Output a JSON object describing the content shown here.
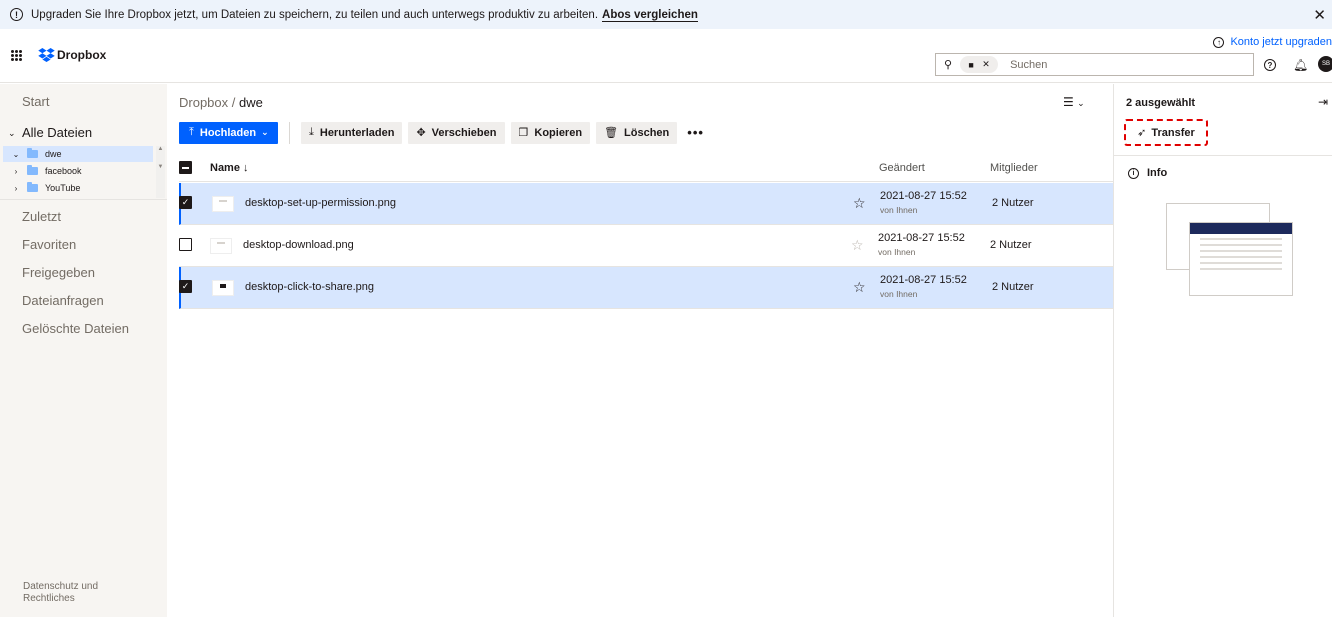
{
  "banner": {
    "text": "Upgraden Sie Ihre Dropbox jetzt, um Dateien zu speichern, zu teilen und auch unterwegs produktiv zu arbeiten.",
    "link": "Abos vergleichen"
  },
  "header": {
    "logo_text": "Dropbox",
    "upgrade_link": "Konto jetzt upgraden",
    "search_placeholder": "Suchen",
    "avatar_initials": "SB"
  },
  "sidebar": {
    "nav": [
      "Start",
      "Alle Dateien",
      "Zuletzt",
      "Favoriten",
      "Freigegeben",
      "Dateianfragen",
      "Gelöschte Dateien"
    ],
    "tree": [
      "dwe",
      "facebook",
      "YouTube"
    ],
    "footer": "Datenschutz und Rechtliches"
  },
  "breadcrumb": {
    "root": "Dropbox",
    "separator": "/",
    "current": "dwe"
  },
  "toolbar": {
    "upload": "Hochladen",
    "download": "Herunterladen",
    "move": "Verschieben",
    "copy": "Kopieren",
    "delete": "Löschen"
  },
  "table": {
    "columns": {
      "name": "Name",
      "modified": "Geändert",
      "members": "Mitglieder"
    },
    "rows": [
      {
        "name": "desktop-set-up-permission.png",
        "modified": "2021-08-27 15:52",
        "by": "von Ihnen",
        "members": "2 Nutzer",
        "selected": true
      },
      {
        "name": "desktop-download.png",
        "modified": "2021-08-27 15:52",
        "by": "von Ihnen",
        "members": "2 Nutzer",
        "selected": false
      },
      {
        "name": "desktop-click-to-share.png",
        "modified": "2021-08-27 15:52",
        "by": "von Ihnen",
        "members": "2 Nutzer",
        "selected": true
      }
    ]
  },
  "right_panel": {
    "title": "2 ausgewählt",
    "transfer": "Transfer",
    "info": "Info"
  },
  "colors": {
    "accent": "#0061fe",
    "selected_row": "#d7e6fe",
    "highlight": "#e00000"
  }
}
